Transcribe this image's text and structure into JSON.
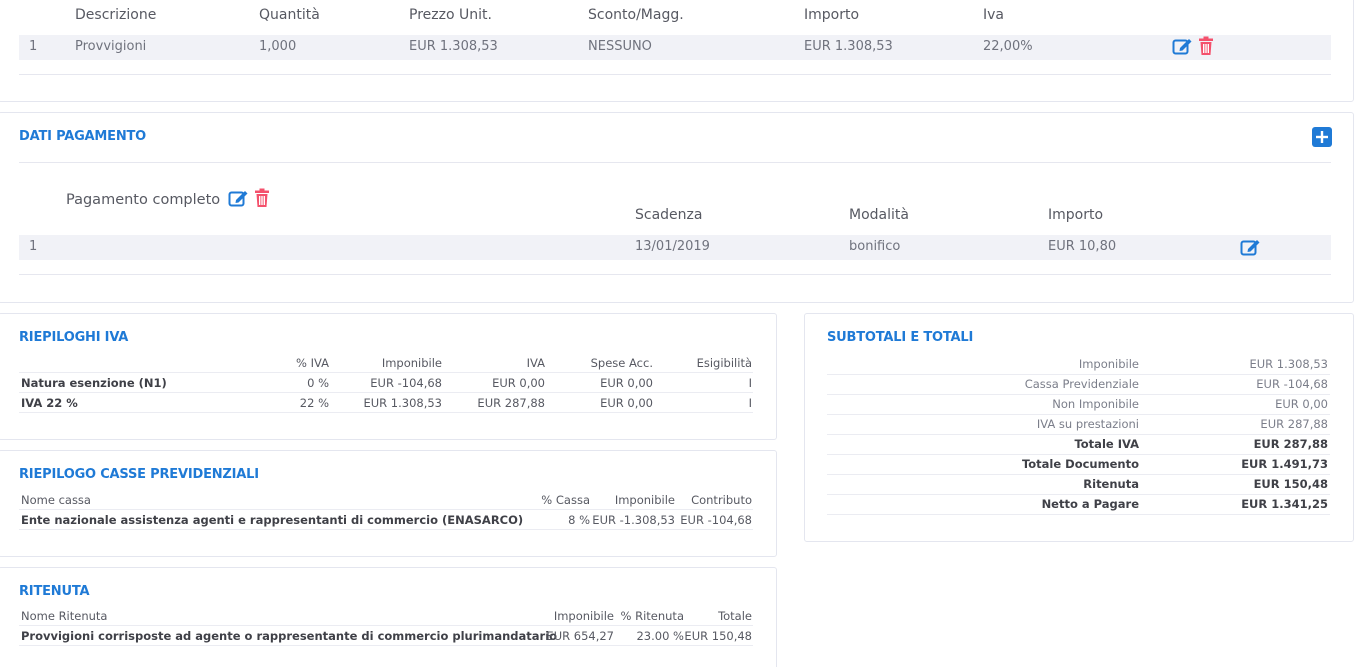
{
  "righe": {
    "headers": [
      "Descrizione",
      "Quantità",
      "Prezzo Unit.",
      "Sconto/Magg.",
      "Importo",
      "Iva"
    ],
    "row": {
      "n": "1",
      "descrizione": "Provvigioni",
      "quantita": "1,000",
      "prezzo": "EUR 1.308,53",
      "sconto": "NESSUNO",
      "importo": "EUR 1.308,53",
      "iva": "22,00%"
    }
  },
  "pagamento": {
    "title": "DATI PAGAMENTO",
    "subtitle": "Pagamento completo",
    "headers": [
      "Scadenza",
      "Modalità",
      "Importo"
    ],
    "row": {
      "n": "1",
      "scadenza": "13/01/2019",
      "modalita": "bonifico",
      "importo": "EUR 10,80"
    }
  },
  "riepiloghi_iva": {
    "title": "RIEPILOGHI IVA",
    "headers": [
      "% IVA",
      "Imponibile",
      "IVA",
      "Spese Acc.",
      "Esigibilità"
    ],
    "rows": [
      {
        "label": "Natura esenzione (N1)",
        "perc": "0 %",
        "imponibile": "EUR -104,68",
        "iva": "EUR 0,00",
        "spese": "EUR 0,00",
        "esig": "I"
      },
      {
        "label": "IVA 22 %",
        "perc": "22 %",
        "imponibile": "EUR 1.308,53",
        "iva": "EUR 287,88",
        "spese": "EUR 0,00",
        "esig": "I"
      }
    ]
  },
  "casse": {
    "title": "RIEPILOGO CASSE PREVIDENZIALI",
    "headers": [
      "Nome cassa",
      "% Cassa",
      "Imponibile",
      "Contributo"
    ],
    "row": {
      "nome": "Ente nazionale assistenza agenti e rappresentanti di commercio (ENASARCO)",
      "perc": "8 %",
      "imponibile": "EUR -1.308,53",
      "contributo": "EUR -104,68"
    }
  },
  "ritenuta": {
    "title": "RITENUTA",
    "headers": [
      "Nome Ritenuta",
      "Imponibile",
      "% Ritenuta",
      "Totale"
    ],
    "row": {
      "nome": "Provvigioni corrisposte ad agente o rappresentante di commercio plurimandatario",
      "imponibile": "EUR 654,27",
      "perc": "23.00 %",
      "totale": "EUR 150,48"
    }
  },
  "totali": {
    "title": "SUBTOTALI E TOTALI",
    "rows": [
      {
        "label": "Imponibile",
        "value": "EUR 1.308,53",
        "bold": false
      },
      {
        "label": "Cassa Previdenziale",
        "value": "EUR -104,68",
        "bold": false
      },
      {
        "label": "Non Imponibile",
        "value": "EUR 0,00",
        "bold": false
      },
      {
        "label": "IVA su prestazioni",
        "value": "EUR 287,88",
        "bold": false
      },
      {
        "label": "Totale IVA",
        "value": "EUR 287,88",
        "bold": true
      },
      {
        "label": "Totale Documento",
        "value": "EUR 1.491,73",
        "bold": true
      },
      {
        "label": "Ritenuta",
        "value": "EUR 150,48",
        "bold": true
      },
      {
        "label": "Netto a Pagare",
        "value": "EUR 1.341,25",
        "bold": true
      }
    ]
  },
  "colors": {
    "accent": "#1f7ad6",
    "danger": "#f4516c",
    "row_bg": "#f1f2f7"
  },
  "icons": [
    "edit-icon",
    "trash-icon",
    "plus-square-icon"
  ]
}
